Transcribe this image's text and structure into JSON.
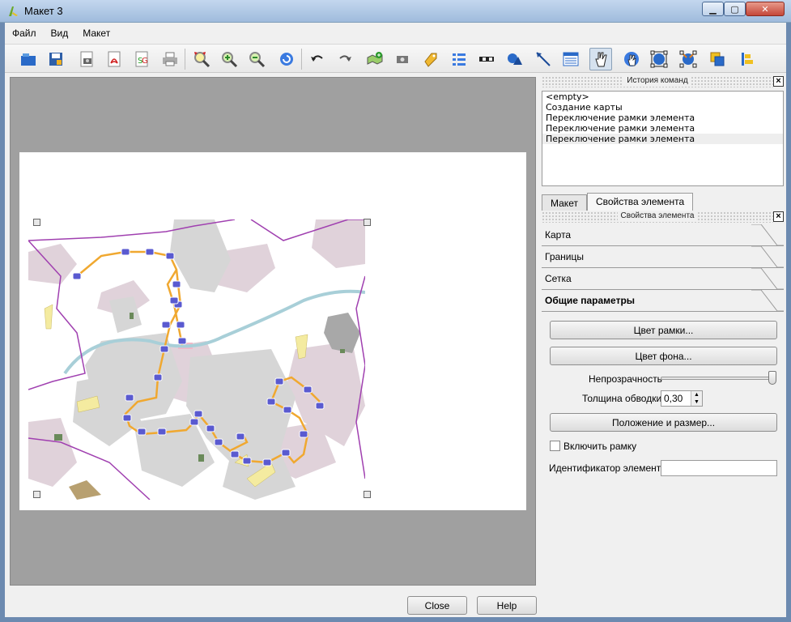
{
  "window": {
    "title": "Макет 3"
  },
  "menu": [
    "Файл",
    "Вид",
    "Макет"
  ],
  "toolbar_icons": [
    "open-icon",
    "save-icon",
    "export-image-icon",
    "export-pdf-icon",
    "export-svg-icon",
    "print-icon",
    "zoom-full-icon",
    "zoom-in-icon",
    "zoom-out-icon",
    "refresh-icon",
    "undo-icon",
    "redo-icon",
    "add-map-icon",
    "add-image-icon",
    "add-label-icon",
    "add-legend-icon",
    "add-scalebar-icon",
    "add-shape-icon",
    "add-arrow-icon",
    "add-table-icon",
    "select-move-icon",
    "move-content-icon",
    "group-icon",
    "ungroup-icon",
    "raise-lower-icon",
    "align-icon"
  ],
  "history": {
    "title": "История команд",
    "items": [
      "<empty>",
      "Создание карты",
      "Переключение рамки элемента",
      "Переключение рамки элемента",
      "Переключение рамки элемента"
    ]
  },
  "tabs": {
    "layout": "Макет",
    "item_props": "Свойства элемента"
  },
  "item_props": {
    "title": "Свойства элемента",
    "sections": [
      "Карта",
      "Границы",
      "Сетка",
      "Общие параметры"
    ],
    "frame_color": "Цвет рамки...",
    "bg_color": "Цвет фона...",
    "opacity_label": "Непрозрачность",
    "opacity_value": 1.0,
    "outline_label": "Толщина обводки",
    "outline_value": "0,30",
    "position_size": "Положение и размер...",
    "enable_frame": "Включить рамку",
    "item_id_label": "Идентификатор элемента",
    "item_id_value": ""
  },
  "footer": {
    "close": "Close",
    "help": "Help"
  },
  "colors": {
    "route": "#f0a830",
    "boundary": "#a040b0",
    "river": "#a8cfd8",
    "stop": "#5a5ad0"
  }
}
